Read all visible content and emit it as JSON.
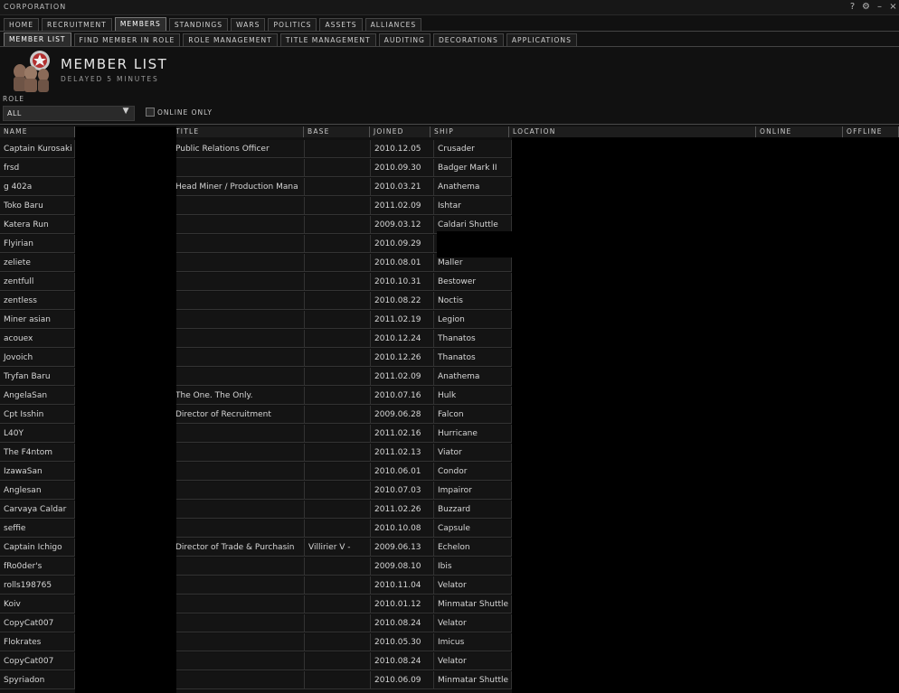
{
  "window": {
    "title": "CORPORATION",
    "controls": {
      "help": "?",
      "settings": "⚙",
      "minimize": "–",
      "close": "×"
    }
  },
  "main_tabs": [
    "HOME",
    "RECRUITMENT",
    "MEMBERS",
    "STANDINGS",
    "WARS",
    "POLITICS",
    "ASSETS",
    "ALLIANCES"
  ],
  "main_tab_active": "MEMBERS",
  "sub_tabs": [
    "MEMBER LIST",
    "FIND MEMBER IN ROLE",
    "ROLE MANAGEMENT",
    "TITLE MANAGEMENT",
    "AUDITING",
    "DECORATIONS",
    "APPLICATIONS"
  ],
  "sub_tab_active": "MEMBER LIST",
  "header": {
    "title": "MEMBER LIST",
    "subtitle": "DELAYED 5 MINUTES"
  },
  "filters": {
    "role_label": "ROLE",
    "role_value": "ALL",
    "online_only_label": "ONLINE ONLY",
    "online_only_checked": false
  },
  "columns": [
    "NAME",
    "TITLE",
    "BASE",
    "JOINED",
    "SHIP",
    "LOCATION",
    "ONLINE",
    "OFFLINE"
  ],
  "members": [
    {
      "name": "Captain Kurosaki",
      "title": "Public Relations Officer",
      "base": "",
      "joined": "2010.12.05",
      "ship": "Crusader"
    },
    {
      "name": "frsd",
      "title": "",
      "base": "",
      "joined": "2010.09.30",
      "ship": "Badger Mark II"
    },
    {
      "name": "g 402a",
      "title": "Head Miner / Production Mana",
      "base": "",
      "joined": "2010.03.21",
      "ship": "Anathema"
    },
    {
      "name": "Toko Baru",
      "title": "",
      "base": "",
      "joined": "2011.02.09",
      "ship": "Ishtar"
    },
    {
      "name": "Katera Run",
      "title": "",
      "base": "",
      "joined": "2009.03.12",
      "ship": "Caldari Shuttle"
    },
    {
      "name": "Flyirian",
      "title": "",
      "base": "",
      "joined": "2010.09.29",
      "ship": ""
    },
    {
      "name": "zeliete",
      "title": "",
      "base": "",
      "joined": "2010.08.01",
      "ship": "Maller"
    },
    {
      "name": "zentfull",
      "title": "",
      "base": "",
      "joined": "2010.10.31",
      "ship": "Bestower"
    },
    {
      "name": "zentless",
      "title": "",
      "base": "",
      "joined": "2010.08.22",
      "ship": "Noctis"
    },
    {
      "name": "Miner asian",
      "title": "",
      "base": "",
      "joined": "2011.02.19",
      "ship": "Legion"
    },
    {
      "name": "acouex",
      "title": "",
      "base": "",
      "joined": "2010.12.24",
      "ship": "Thanatos"
    },
    {
      "name": "Jovoich",
      "title": "",
      "base": "",
      "joined": "2010.12.26",
      "ship": "Thanatos"
    },
    {
      "name": "Tryfan Baru",
      "title": "",
      "base": "",
      "joined": "2011.02.09",
      "ship": "Anathema"
    },
    {
      "name": "AngelaSan",
      "title": "The One. The Only.",
      "base": "",
      "joined": "2010.07.16",
      "ship": "Hulk"
    },
    {
      "name": "Cpt Isshin",
      "title": "Director of Recruitment",
      "base": "",
      "joined": "2009.06.28",
      "ship": "Falcon"
    },
    {
      "name": "L40Y",
      "title": "",
      "base": "",
      "joined": "2011.02.16",
      "ship": "Hurricane"
    },
    {
      "name": "The F4ntom",
      "title": "",
      "base": "",
      "joined": "2011.02.13",
      "ship": "Viator"
    },
    {
      "name": "IzawaSan",
      "title": "",
      "base": "",
      "joined": "2010.06.01",
      "ship": "Condor"
    },
    {
      "name": "Anglesan",
      "title": "",
      "base": "",
      "joined": "2010.07.03",
      "ship": "Impairor"
    },
    {
      "name": "Carvaya Caldar",
      "title": "",
      "base": "",
      "joined": "2011.02.26",
      "ship": "Buzzard"
    },
    {
      "name": "seffie",
      "title": "",
      "base": "",
      "joined": "2010.10.08",
      "ship": "Capsule"
    },
    {
      "name": "Captain Ichigo",
      "title": "Director of Trade & Purchasin",
      "base": "Villirier V -",
      "joined": "2009.06.13",
      "ship": "Echelon"
    },
    {
      "name": "fRo0der's",
      "title": "",
      "base": "",
      "joined": "2009.08.10",
      "ship": "Ibis"
    },
    {
      "name": "rolls198765",
      "title": "",
      "base": "",
      "joined": "2010.11.04",
      "ship": "Velator"
    },
    {
      "name": "Koiv",
      "title": "",
      "base": "",
      "joined": "2010.01.12",
      "ship": "Minmatar Shuttle"
    },
    {
      "name": "CopyCat007",
      "title": "",
      "base": "",
      "joined": "2010.08.24",
      "ship": "Velator"
    },
    {
      "name": "Flokrates",
      "title": "",
      "base": "",
      "joined": "2010.05.30",
      "ship": "Imicus"
    },
    {
      "name": "CopyCat007",
      "title": "",
      "base": "",
      "joined": "2010.08.24",
      "ship": "Velator"
    },
    {
      "name": "Spyriadon",
      "title": "",
      "base": "",
      "joined": "2010.06.09",
      "ship": "Minmatar Shuttle"
    }
  ]
}
